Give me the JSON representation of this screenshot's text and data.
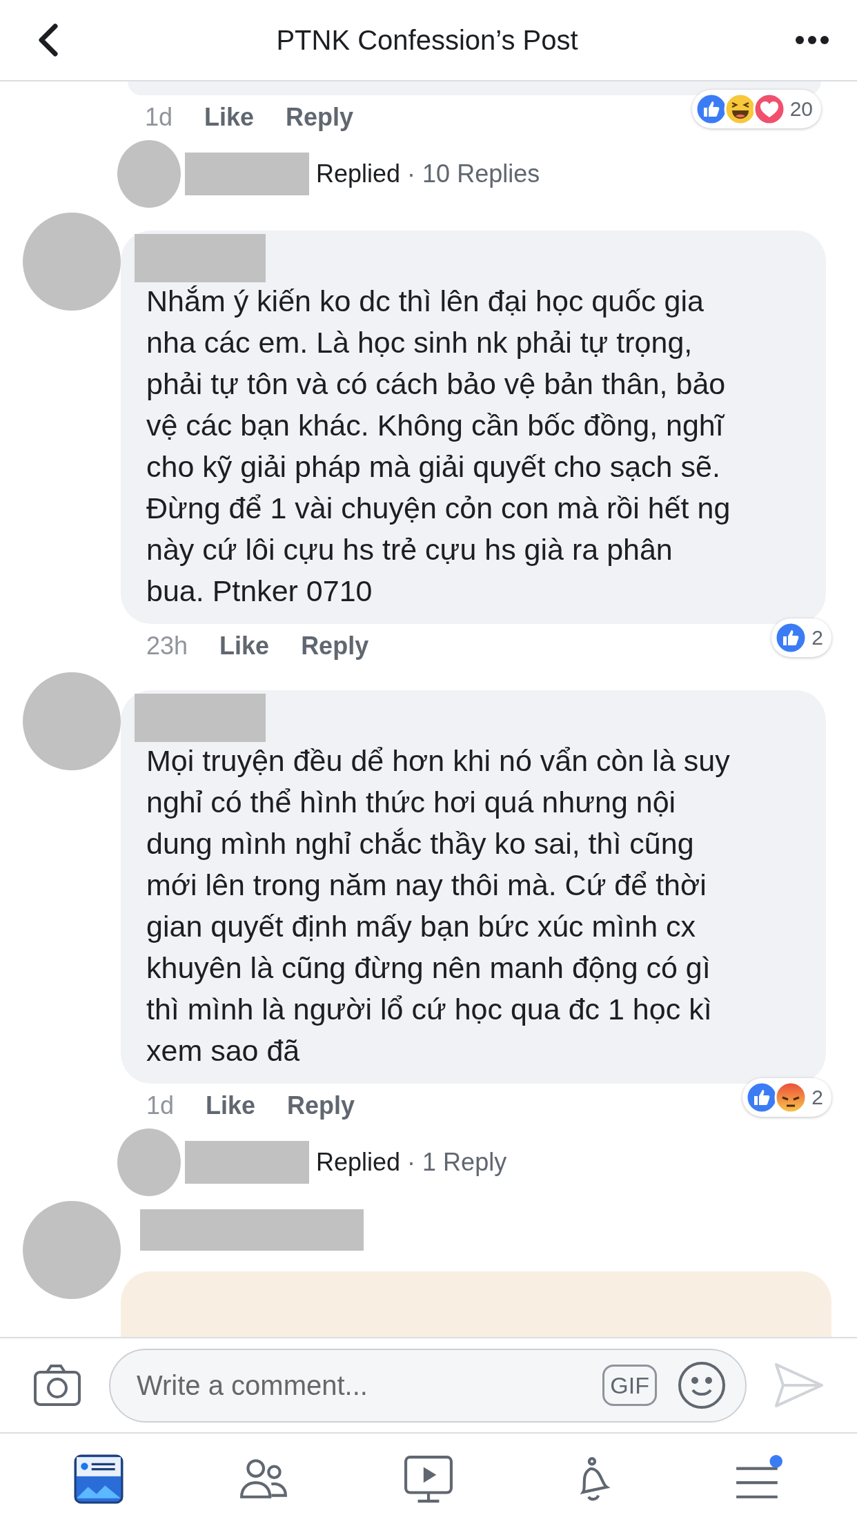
{
  "header": {
    "title": "PTNK Confession’s Post"
  },
  "comments": [
    {
      "kind": "tail",
      "time": "1d",
      "like": "Like",
      "reply": "Reply",
      "reactions": {
        "types": [
          {
            "kind": "like"
          },
          {
            "kind": "haha"
          },
          {
            "kind": "love"
          }
        ],
        "count": "20"
      },
      "replies": {
        "label": "Replied",
        "count": "· 10 Replies"
      }
    },
    {
      "kind": "text",
      "lines": [
        "Nhắm ý kiến ko dc thì lên đại học quốc gia",
        "nha các em. Là học sinh nk phải tự trọng,",
        "phải tự tôn và có cách bảo vệ bản thân, bảo",
        "vệ các bạn khác. Không cần bốc đồng, nghĩ",
        "cho kỹ giải pháp mà giải quyết cho sạch sẽ.",
        "Đừng để 1 vài chuyện cỏn con mà rồi hết ng",
        "này cứ lôi cựu hs trẻ cựu hs già ra phân",
        "bua. Ptnker 0710"
      ],
      "time": "23h",
      "like": "Like",
      "reply": "Reply",
      "reactions": {
        "types": [
          {
            "kind": "like"
          }
        ],
        "count": "2"
      }
    },
    {
      "kind": "text",
      "lines": [
        "Mọi truyện đều dể hơn khi nó vẩn còn là suy",
        "nghỉ có thể hình thức hơi quá nhưng nội",
        "dung mình nghỉ chắc thầy ko sai, thì cũng",
        "mới lên trong năm nay thôi mà. Cứ để thời",
        "gian quyết định mấy bạn bức xúc mình cx",
        "khuyên là cũng đừng nên manh động có gì",
        "thì mình là người lổ cứ học qua đc 1 học kì",
        "xem sao đã"
      ],
      "time": "1d",
      "like": "Like",
      "reply": "Reply",
      "reactions": {
        "types": [
          {
            "kind": "like"
          },
          {
            "kind": "angry"
          }
        ],
        "count": "2"
      },
      "replies": {
        "label": "Replied",
        "count": "· 1 Reply"
      }
    },
    {
      "kind": "sticker"
    }
  ],
  "composer": {
    "placeholder": "Write a comment...",
    "gif": "GIF"
  },
  "tabs": [
    {
      "kind": "news",
      "selected": true
    },
    {
      "kind": "friends",
      "selected": false
    },
    {
      "kind": "watch",
      "selected": false
    },
    {
      "kind": "notifications",
      "selected": false
    },
    {
      "kind": "menu",
      "selected": false,
      "badge": true
    }
  ]
}
